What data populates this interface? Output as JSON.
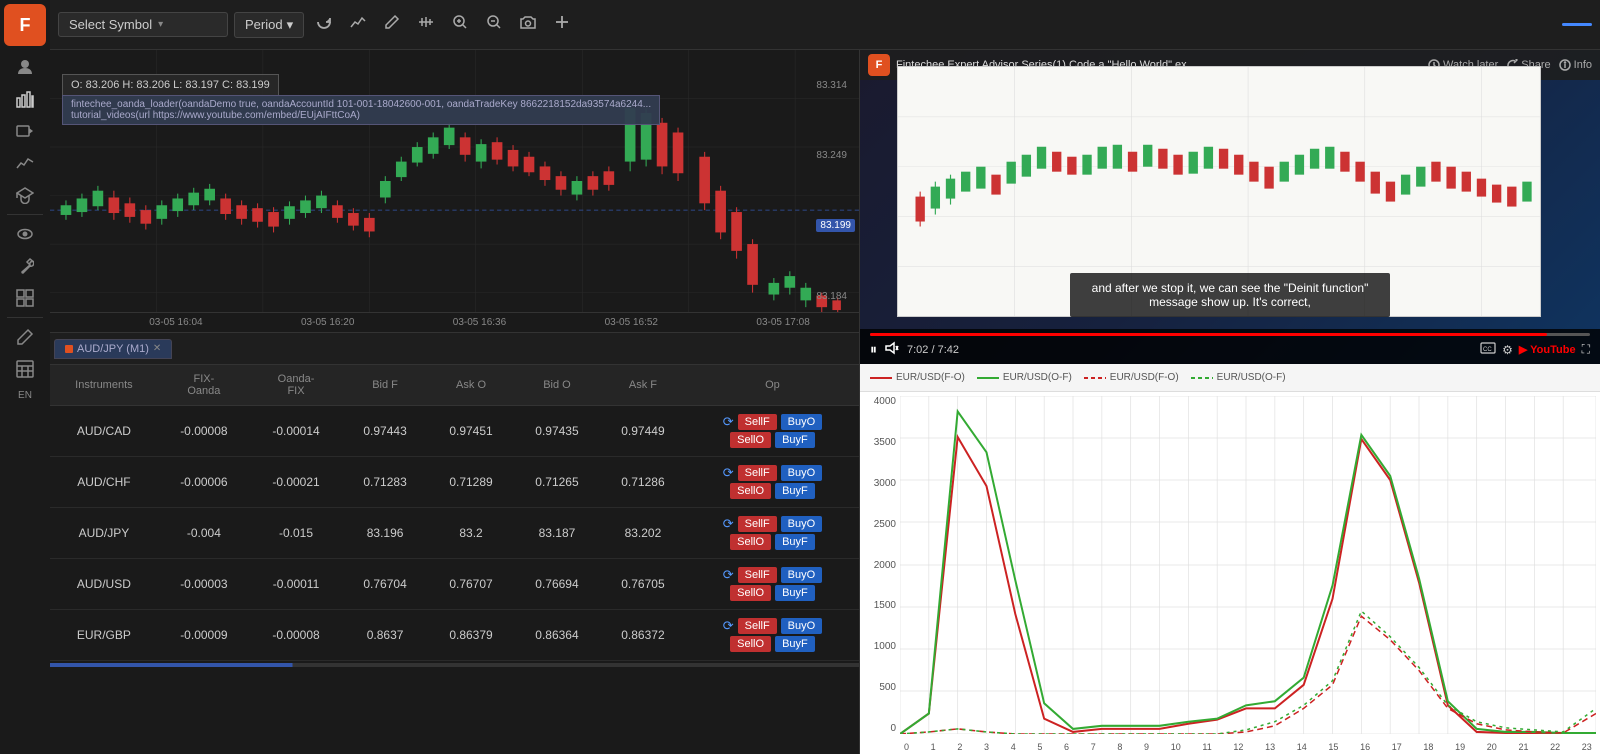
{
  "sidebar": {
    "logo": "F",
    "icons": [
      {
        "name": "person-icon",
        "symbol": "👤"
      },
      {
        "name": "chart-icon",
        "symbol": "📊"
      },
      {
        "name": "video-icon",
        "symbol": "🎬"
      },
      {
        "name": "graph-icon",
        "symbol": "📈"
      },
      {
        "name": "graduation-icon",
        "symbol": "🎓"
      },
      {
        "name": "eye-icon",
        "symbol": "👁"
      },
      {
        "name": "tool-icon",
        "symbol": "🔧"
      },
      {
        "name": "grid-icon",
        "symbol": "⊞"
      },
      {
        "name": "pencil-icon",
        "symbol": "✏"
      },
      {
        "name": "table-icon",
        "symbol": "▦"
      },
      {
        "name": "lang-label",
        "symbol": "EN"
      }
    ]
  },
  "toolbar": {
    "symbol_placeholder": "Select Symbol",
    "period_label": "Period",
    "period_arrow": "▾"
  },
  "chart": {
    "tooltip": "O: 83.206  H: 83.206  L: 83.197  C: 83.199",
    "tooltip_code": "fintechee_oanda_loader(oandaDemo true, oandaAccountId 101-001-18042600-001, oandaTradeKey 8662218152da93574a6244... tutorial_videos(url https://www.youtube.com/embed/EUjAIFttCoA)",
    "price_labels": [
      "83.314",
      "83.249",
      "83.199",
      "83.184"
    ],
    "time_labels": [
      "03-05 16:04",
      "03-05 16:20",
      "03-05 16:36",
      "03-05 16:52",
      "03-05 17:08"
    ],
    "tab_symbol": "AUD/JPY",
    "tab_period": "M1"
  },
  "video": {
    "title": "Fintechee Expert Advisor Series(1) Code a \"Hello World\" ex...",
    "time_current": "7:02",
    "time_total": "7:42",
    "progress_pct": 94,
    "subtitle": "and after we stop it, we can see the \"Deinit function\" message show up. It's correct,",
    "actions": {
      "watch_later": "Watch later",
      "share": "Share",
      "info": "Info"
    }
  },
  "instruments_table": {
    "headers": [
      "Instruments",
      "FIX-Oanda",
      "Oanda-FIX",
      "Bid F",
      "Ask O",
      "Bid O",
      "Ask F",
      "Op"
    ],
    "rows": [
      {
        "instrument": "AUD/CAD",
        "fix_oanda": "-0.00008",
        "oanda_fix": "-0.00014",
        "bid_f": "0.97443",
        "ask_o": "0.97451",
        "bid_o": "0.97435",
        "ask_f": "0.97449",
        "sell_f": "SellF",
        "buy_o": "BuyO",
        "sell_o": "SellO",
        "buy_f": "BuyF"
      },
      {
        "instrument": "AUD/CHF",
        "fix_oanda": "-0.00006",
        "oanda_fix": "-0.00021",
        "bid_f": "0.71283",
        "ask_o": "0.71289",
        "bid_o": "0.71265",
        "ask_f": "0.71286",
        "sell_f": "SellF",
        "buy_o": "BuyO",
        "sell_o": "SellO",
        "buy_f": "BuyF"
      },
      {
        "instrument": "AUD/JPY",
        "fix_oanda": "-0.004",
        "oanda_fix": "-0.015",
        "bid_f": "83.196",
        "ask_o": "83.2",
        "bid_o": "83.187",
        "ask_f": "83.202",
        "sell_f": "SellF",
        "buy_o": "BuyO",
        "sell_o": "SellO",
        "buy_f": "BuyF"
      },
      {
        "instrument": "AUD/USD",
        "fix_oanda": "-0.00003",
        "oanda_fix": "-0.00011",
        "bid_f": "0.76704",
        "ask_o": "0.76707",
        "bid_o": "0.76694",
        "ask_f": "0.76705",
        "sell_f": "SellF",
        "buy_o": "BuyO",
        "sell_o": "SellO",
        "buy_f": "BuyF"
      },
      {
        "instrument": "EUR/GBP",
        "fix_oanda": "-0.00009",
        "oanda_fix": "-0.00008",
        "bid_f": "0.8637",
        "ask_o": "0.86379",
        "bid_o": "0.86364",
        "ask_f": "0.86372",
        "sell_f": "SellF",
        "buy_o": "BuyO",
        "sell_o": "SellO",
        "buy_f": "BuyF"
      }
    ]
  },
  "bottom_chart": {
    "legend": [
      {
        "label": "EUR/USD(F-O)",
        "type": "solid-red"
      },
      {
        "label": "EUR/USD(O-F)",
        "type": "solid-green"
      },
      {
        "label": "EUR/USD(F-O)",
        "type": "dashed-red"
      },
      {
        "label": "EUR/USD(O-F)",
        "type": "dashed-green"
      }
    ],
    "y_axis": [
      "4000",
      "3500",
      "3000",
      "2500",
      "2000",
      "1500",
      "1000",
      "500",
      "0"
    ],
    "x_axis": [
      "0",
      "1",
      "2",
      "3",
      "4",
      "5",
      "6",
      "7",
      "8",
      "9",
      "10",
      "11",
      "12",
      "13",
      "14",
      "15",
      "16",
      "17",
      "18",
      "19",
      "20",
      "21",
      "22",
      "23"
    ]
  }
}
